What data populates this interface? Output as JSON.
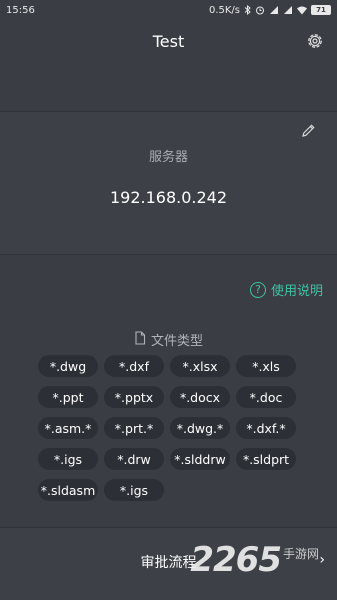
{
  "status_bar": {
    "time": "15:56",
    "network_speed": "0.5K/s",
    "battery": "71",
    "icons": [
      "bluetooth-icon",
      "alarm-icon",
      "signal-icon",
      "signal-icon",
      "wifi-icon",
      "battery-icon"
    ]
  },
  "header": {
    "title": "Test",
    "settings_icon": "gear-icon"
  },
  "server": {
    "label": "服务器",
    "address": "192.168.0.242",
    "edit_icon": "pencil-icon"
  },
  "help": {
    "label": "使用说明",
    "icon": "question-circle-icon"
  },
  "file_types": {
    "heading": "文件类型",
    "icon": "document-icon",
    "items": [
      "*.dwg",
      "*.dxf",
      "*.xlsx",
      "*.xls",
      "*.ppt",
      "*.pptx",
      "*.docx",
      "*.doc",
      "*.asm.*",
      "*.prt.*",
      "*.dwg.*",
      "*.dxf.*",
      "*.igs",
      "*.drw",
      "*.slddrw",
      "*.sldprt",
      "*.sldasm",
      "*.igs"
    ]
  },
  "approval": {
    "label": "审批流程",
    "arrow": "›"
  },
  "watermark": {
    "number": "2265",
    "text": "手游网"
  },
  "colors": {
    "background": "#3a3d44",
    "card": "#3d4047",
    "accent": "#3fc3a4",
    "tag_bg": "#2c2f35"
  }
}
